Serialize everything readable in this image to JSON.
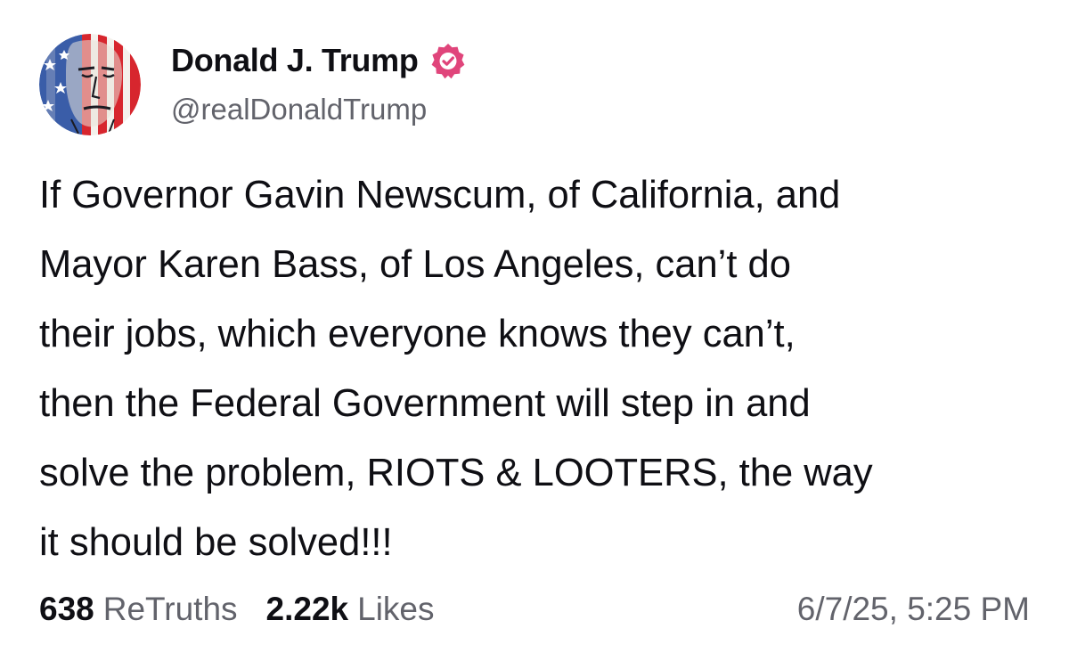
{
  "author": {
    "display_name": "Donald J. Trump",
    "handle": "@realDonaldTrump",
    "verified": true,
    "verified_color": "#e0457b",
    "avatar_icon": "flag-portrait-avatar"
  },
  "post": {
    "lines": [
      "If Governor Gavin Newscum, of California, and",
      "Mayor Karen Bass, of Los Angeles, can’t do",
      "their jobs, which everyone knows they can’t,",
      "then the Federal Government will step in and",
      "solve the problem, RIOTS & LOOTERS, the way",
      "it should be solved!!!"
    ]
  },
  "stats": {
    "retruths_count": "638",
    "retruths_label": "ReTruths",
    "likes_count": "2.22k",
    "likes_label": "Likes"
  },
  "timestamp": "6/7/25, 5:25 PM",
  "colors": {
    "text": "#0f0f14",
    "muted": "#62636b",
    "background": "#ffffff"
  }
}
